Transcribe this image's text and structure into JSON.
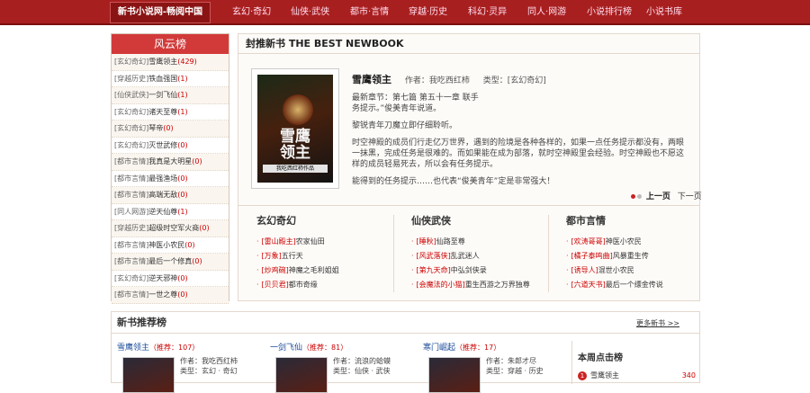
{
  "nav": {
    "logo": "新书小说网-畅阅中国",
    "items": [
      "玄幻·奇幻",
      "仙侠·武侠",
      "都市·言情",
      "穿越·历史",
      "科幻·灵异",
      "同人·网游",
      "小说排行榜",
      "小说书库"
    ]
  },
  "sidebar": {
    "title": "风云榜",
    "items": [
      {
        "cat": "[玄幻奇幻]",
        "name": "雪鹰领主",
        "count": "(429)"
      },
      {
        "cat": "[穿越历史]",
        "name": "铁血强国",
        "count": "(1)"
      },
      {
        "cat": "[仙侠武侠]",
        "name": "一剑飞仙",
        "count": "(1)"
      },
      {
        "cat": "[玄幻奇幻]",
        "name": "诸天至尊",
        "count": "(1)"
      },
      {
        "cat": "[玄幻奇幻]",
        "name": "琴帝",
        "count": "(0)"
      },
      {
        "cat": "[玄幻奇幻]",
        "name": "灭世武修",
        "count": "(0)"
      },
      {
        "cat": "[都市言情]",
        "name": "我真是大明星",
        "count": "(0)"
      },
      {
        "cat": "[都市言情]",
        "name": "最强渔场",
        "count": "(0)"
      },
      {
        "cat": "[都市言情]",
        "name": "高端无敌",
        "count": "(0)"
      },
      {
        "cat": "[同人网游]",
        "name": "逆天仙尊",
        "count": "(1)"
      },
      {
        "cat": "[穿越历史]",
        "name": "超级时空军火商",
        "count": "(0)"
      },
      {
        "cat": "[都市言情]",
        "name": "神医小农民",
        "count": "(0)"
      },
      {
        "cat": "[都市言情]",
        "name": "最后一个修真",
        "count": "(0)"
      },
      {
        "cat": "[玄幻奇幻]",
        "name": "逆天邪神",
        "count": "(0)"
      },
      {
        "cat": "[都市言情]",
        "name": "一世之尊",
        "count": "(0)"
      }
    ]
  },
  "feature": {
    "heading": "封推新书 THE BEST NEWBOOK",
    "cover_title": "雪鹰\n领主",
    "cover_sub": "我吃西红柿作品",
    "book_title": "雪鹰领主",
    "author": "作者：我吃西红柿",
    "category": "类型：[玄幻奇幻]",
    "latest_line1": "最新章节：第七篇 第五十一章 联手",
    "latest_line2": "务提示。”俊美青年说道。",
    "p1": "黎锐青年刀魔立即仔细聆听。",
    "p2": "时空神殿的成员们行走亿万世界，遇到的险境是各种各样的，如果一点任务提示都没有，两眼一抹黑，完成任务是很难的。而如果能在成为部落，就时空神殿里会经验。时空神殿也不愿这样的成员轻易死去，所以会有任务提示。",
    "p3": "能得到的任务提示……也代表“俊美青年”定是非常强大！",
    "prev": "上一页",
    "next": "下一页"
  },
  "columns": [
    {
      "title": "玄幻奇幻",
      "items": [
        {
          "tag": "[雷山殿主]",
          "name": "农家仙田"
        },
        {
          "tag": "[万象]",
          "name": "五行天"
        },
        {
          "tag": "[炒鸡碗]",
          "name": "神魔之毛利姐姐"
        },
        {
          "tag": "[贝贝君]",
          "name": "都市奇缘"
        }
      ]
    },
    {
      "title": "仙侠武侠",
      "items": [
        {
          "tag": "[睡秋]",
          "name": "仙路至尊"
        },
        {
          "tag": "[风武落侠]",
          "name": "乱武迷人"
        },
        {
          "tag": "[第九天命]",
          "name": "中弘剑侠录"
        },
        {
          "tag": "[会魔法的小猫]",
          "name": "重生西游之万界独尊"
        }
      ]
    },
    {
      "title": "都市言情",
      "items": [
        {
          "tag": "[欢涛哥哥]",
          "name": "神医小农民"
        },
        {
          "tag": "[橘子泰鸣曲]",
          "name": "风暴重生传"
        },
        {
          "tag": "[诱导人]",
          "name": "混世小农民"
        },
        {
          "tag": "[六道天书]",
          "name": "最后一个缥金传说"
        }
      ]
    }
  ],
  "recommend": {
    "heading": "新书推荐榜",
    "more": "更多新书 >>",
    "cards": [
      {
        "title": "雪鹰领主",
        "score": "（推荐：107）",
        "author": "作者：我吃西红柿",
        "type": "类型：玄幻 · 奇幻"
      },
      {
        "title": "一剑飞仙",
        "score": "（推荐：81）",
        "author": "作者：流浪的蛤蟆",
        "type": "类型：仙侠 · 武侠"
      },
      {
        "title": "寒门崛起",
        "score": "（推荐：17）",
        "author": "作者：朱郎才尽",
        "type": "类型：穿越 · 历史"
      }
    ],
    "weekly_title": "本周点击榜",
    "weekly_rank": "1",
    "weekly_name": "雪鹰领主",
    "weekly_count": "340"
  }
}
